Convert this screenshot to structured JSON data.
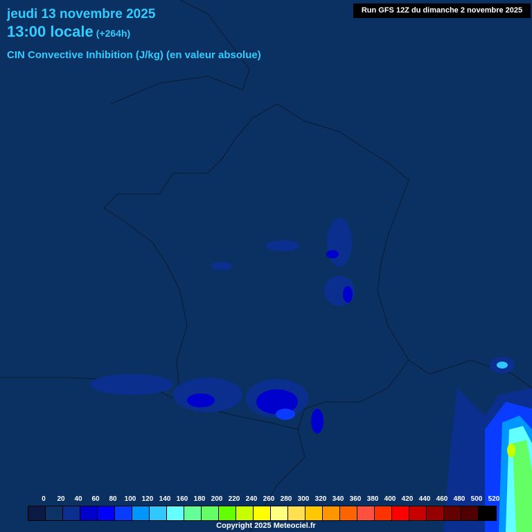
{
  "header": {
    "date": "jeudi 13 novembre 2025",
    "time": "13:00 locale",
    "lead": "(+264h)",
    "parameter": "CIN Convective Inhibition (J/kg) (en valeur absolue)",
    "run": "Run GFS 12Z du dimanche 2 novembre 2025"
  },
  "legend": {
    "labels": [
      "0",
      "20",
      "40",
      "60",
      "80",
      "100",
      "120",
      "140",
      "160",
      "180",
      "200",
      "220",
      "240",
      "260",
      "280",
      "300",
      "320",
      "340",
      "360",
      "380",
      "400",
      "420",
      "440",
      "460",
      "480",
      "500",
      "520"
    ],
    "colors": [
      "#0b1a45",
      "#0b3366",
      "#0a2f8f",
      "#0000cc",
      "#0000ff",
      "#0a3cff",
      "#0096ff",
      "#32c8ff",
      "#64ffff",
      "#64ff96",
      "#64ff64",
      "#64ff00",
      "#c8ff00",
      "#ffff00",
      "#ffff80",
      "#ffe050",
      "#ffc800",
      "#ff9600",
      "#ff6400",
      "#ff5040",
      "#ff3200",
      "#ff0000",
      "#c80000",
      "#960000",
      "#640000",
      "#500000",
      "#000000"
    ]
  },
  "copyright": "Copyright 2025 Meteociel.fr"
}
